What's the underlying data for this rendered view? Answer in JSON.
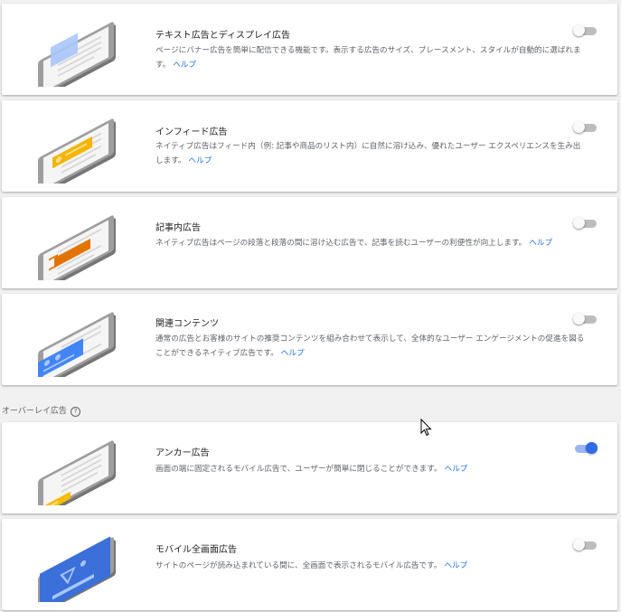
{
  "help_label": "ヘルプ",
  "colors": {
    "toggle_off": "#bdbdbd",
    "toggle_on": "#2e6be6",
    "link": "#1a73e8"
  },
  "cards": [
    {
      "title": "テキスト広告とディスプレイ広告",
      "desc_lines": [
        "ページにバナー広告を簡単に配信できる機能です。表示する広告のサイズ、プレースメント、スタイルが自動的に選ばれま",
        "す。"
      ],
      "toggle": "off",
      "icon": "text-display-ad-illustration"
    },
    {
      "title": "インフィード広告",
      "desc_lines": [
        "ネイティブ広告はフィード内（例: 記事や商品のリスト内）に自然に溶け込み、優れたユーザー エクスペリエンスを生み出",
        "します。"
      ],
      "toggle": "off",
      "icon": "in-feed-ad-illustration"
    },
    {
      "title": "記事内広告",
      "desc_lines": [
        "ネイティブ広告はページの段落と段落の間に溶け込む広告で、記事を読むユーザーの利便性が向上します。"
      ],
      "toggle": "off",
      "icon": "in-article-ad-illustration"
    },
    {
      "title": "関連コンテンツ",
      "desc_lines": [
        "通常の広告とお客様のサイトの推奨コンテンツを組み合わせて表示して、全体的なユーザー エンゲージメントの促進を図る",
        "ことができるネイティブ広告です。"
      ],
      "toggle": "off",
      "icon": "matched-content-illustration"
    },
    {
      "title": "アンカー広告",
      "desc_lines": [
        "画面の端に固定されるモバイル広告で、ユーザーが簡単に閉じることができます。"
      ],
      "toggle": "on",
      "icon": "anchor-ad-illustration"
    },
    {
      "title": "モバイル全画面広告",
      "desc_lines": [
        "サイトのページが読み込まれている間に、全画面で表示されるモバイル広告です。"
      ],
      "toggle": "off",
      "icon": "vignette-ad-illustration"
    }
  ],
  "overlay_section": {
    "label": "オーバーレイ広告",
    "icon": "help-circle-icon"
  }
}
